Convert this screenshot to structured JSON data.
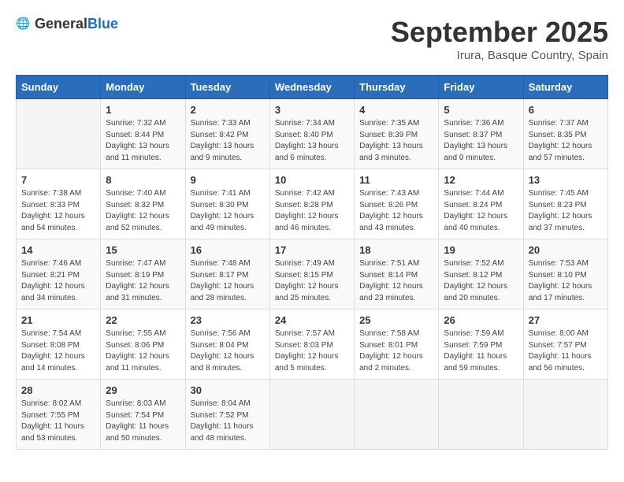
{
  "header": {
    "logo_general": "General",
    "logo_blue": "Blue",
    "month": "September 2025",
    "location": "Irura, Basque Country, Spain"
  },
  "weekdays": [
    "Sunday",
    "Monday",
    "Tuesday",
    "Wednesday",
    "Thursday",
    "Friday",
    "Saturday"
  ],
  "weeks": [
    [
      {
        "day": "",
        "info": ""
      },
      {
        "day": "1",
        "info": "Sunrise: 7:32 AM\nSunset: 8:44 PM\nDaylight: 13 hours\nand 11 minutes."
      },
      {
        "day": "2",
        "info": "Sunrise: 7:33 AM\nSunset: 8:42 PM\nDaylight: 13 hours\nand 9 minutes."
      },
      {
        "day": "3",
        "info": "Sunrise: 7:34 AM\nSunset: 8:40 PM\nDaylight: 13 hours\nand 6 minutes."
      },
      {
        "day": "4",
        "info": "Sunrise: 7:35 AM\nSunset: 8:39 PM\nDaylight: 13 hours\nand 3 minutes."
      },
      {
        "day": "5",
        "info": "Sunrise: 7:36 AM\nSunset: 8:37 PM\nDaylight: 13 hours\nand 0 minutes."
      },
      {
        "day": "6",
        "info": "Sunrise: 7:37 AM\nSunset: 8:35 PM\nDaylight: 12 hours\nand 57 minutes."
      }
    ],
    [
      {
        "day": "7",
        "info": "Sunrise: 7:38 AM\nSunset: 8:33 PM\nDaylight: 12 hours\nand 54 minutes."
      },
      {
        "day": "8",
        "info": "Sunrise: 7:40 AM\nSunset: 8:32 PM\nDaylight: 12 hours\nand 52 minutes."
      },
      {
        "day": "9",
        "info": "Sunrise: 7:41 AM\nSunset: 8:30 PM\nDaylight: 12 hours\nand 49 minutes."
      },
      {
        "day": "10",
        "info": "Sunrise: 7:42 AM\nSunset: 8:28 PM\nDaylight: 12 hours\nand 46 minutes."
      },
      {
        "day": "11",
        "info": "Sunrise: 7:43 AM\nSunset: 8:26 PM\nDaylight: 12 hours\nand 43 minutes."
      },
      {
        "day": "12",
        "info": "Sunrise: 7:44 AM\nSunset: 8:24 PM\nDaylight: 12 hours\nand 40 minutes."
      },
      {
        "day": "13",
        "info": "Sunrise: 7:45 AM\nSunset: 8:23 PM\nDaylight: 12 hours\nand 37 minutes."
      }
    ],
    [
      {
        "day": "14",
        "info": "Sunrise: 7:46 AM\nSunset: 8:21 PM\nDaylight: 12 hours\nand 34 minutes."
      },
      {
        "day": "15",
        "info": "Sunrise: 7:47 AM\nSunset: 8:19 PM\nDaylight: 12 hours\nand 31 minutes."
      },
      {
        "day": "16",
        "info": "Sunrise: 7:48 AM\nSunset: 8:17 PM\nDaylight: 12 hours\nand 28 minutes."
      },
      {
        "day": "17",
        "info": "Sunrise: 7:49 AM\nSunset: 8:15 PM\nDaylight: 12 hours\nand 25 minutes."
      },
      {
        "day": "18",
        "info": "Sunrise: 7:51 AM\nSunset: 8:14 PM\nDaylight: 12 hours\nand 23 minutes."
      },
      {
        "day": "19",
        "info": "Sunrise: 7:52 AM\nSunset: 8:12 PM\nDaylight: 12 hours\nand 20 minutes."
      },
      {
        "day": "20",
        "info": "Sunrise: 7:53 AM\nSunset: 8:10 PM\nDaylight: 12 hours\nand 17 minutes."
      }
    ],
    [
      {
        "day": "21",
        "info": "Sunrise: 7:54 AM\nSunset: 8:08 PM\nDaylight: 12 hours\nand 14 minutes."
      },
      {
        "day": "22",
        "info": "Sunrise: 7:55 AM\nSunset: 8:06 PM\nDaylight: 12 hours\nand 11 minutes."
      },
      {
        "day": "23",
        "info": "Sunrise: 7:56 AM\nSunset: 8:04 PM\nDaylight: 12 hours\nand 8 minutes."
      },
      {
        "day": "24",
        "info": "Sunrise: 7:57 AM\nSunset: 8:03 PM\nDaylight: 12 hours\nand 5 minutes."
      },
      {
        "day": "25",
        "info": "Sunrise: 7:58 AM\nSunset: 8:01 PM\nDaylight: 12 hours\nand 2 minutes."
      },
      {
        "day": "26",
        "info": "Sunrise: 7:59 AM\nSunset: 7:59 PM\nDaylight: 11 hours\nand 59 minutes."
      },
      {
        "day": "27",
        "info": "Sunrise: 8:00 AM\nSunset: 7:57 PM\nDaylight: 11 hours\nand 56 minutes."
      }
    ],
    [
      {
        "day": "28",
        "info": "Sunrise: 8:02 AM\nSunset: 7:55 PM\nDaylight: 11 hours\nand 53 minutes."
      },
      {
        "day": "29",
        "info": "Sunrise: 8:03 AM\nSunset: 7:54 PM\nDaylight: 11 hours\nand 50 minutes."
      },
      {
        "day": "30",
        "info": "Sunrise: 8:04 AM\nSunset: 7:52 PM\nDaylight: 11 hours\nand 48 minutes."
      },
      {
        "day": "",
        "info": ""
      },
      {
        "day": "",
        "info": ""
      },
      {
        "day": "",
        "info": ""
      },
      {
        "day": "",
        "info": ""
      }
    ]
  ]
}
